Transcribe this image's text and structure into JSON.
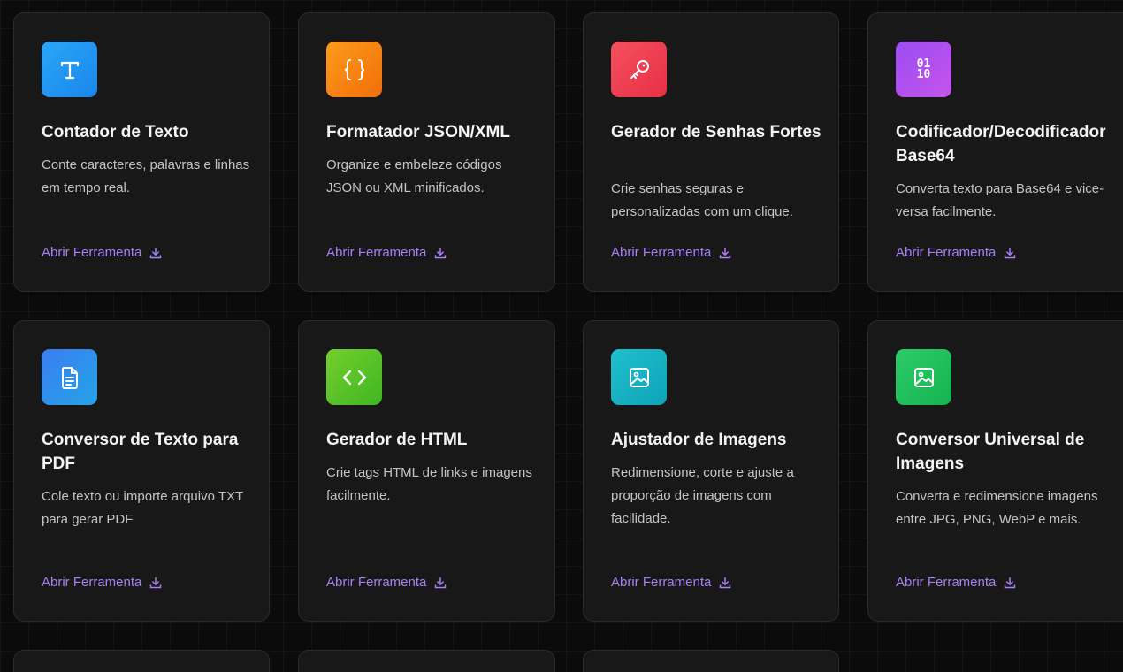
{
  "tools": [
    {
      "title": "Contador de Texto",
      "description": "Conte caracteres, palavras e linhas em tempo real.",
      "link": "Abrir Ferramenta",
      "icon": "text-icon",
      "color": "#2196f3"
    },
    {
      "title": "Formatador JSON/XML",
      "description": "Organize e embeleze códigos JSON ou XML minificados.",
      "link": "Abrir Ferramenta",
      "icon": "braces-icon",
      "color": "#f7870f"
    },
    {
      "title": "Gerador de Senhas Fortes",
      "description": "Crie senhas seguras e personalizadas com um clique.",
      "link": "Abrir Ferramenta",
      "icon": "key-icon",
      "color": "#f03e4e"
    },
    {
      "title": "Codificador/Decodificador Base64",
      "description": "Converta texto para Base64 e vice-versa facilmente.",
      "link": "Abrir Ferramenta",
      "icon": "binary-icon",
      "icon_text": "01 10",
      "color": "#b14ff0"
    },
    {
      "title": "Conversor de Texto para PDF",
      "description": "Cole texto ou importe arquivo TXT para gerar PDF",
      "link": "Abrir Ferramenta",
      "icon": "document-icon",
      "color": "#2f8af0"
    },
    {
      "title": "Gerador de HTML",
      "description": "Crie tags HTML de links e imagens facilmente.",
      "link": "Abrir Ferramenta",
      "icon": "code-icon",
      "color": "#5cc21e"
    },
    {
      "title": "Ajustador de Imagens",
      "description": "Redimensione, corte e ajuste a proporção de imagens com facilidade.",
      "link": "Abrir Ferramenta",
      "icon": "image-icon",
      "color": "#14b4c4"
    },
    {
      "title": "Conversor Universal de Imagens",
      "description": "Converta e redimensione imagens entre JPG, PNG, WebP e mais.",
      "link": "Abrir Ferramenta",
      "icon": "image-icon",
      "color": "#20c35e"
    }
  ],
  "colors": {
    "background": "#0b0b0c",
    "card": "#181818",
    "link": "#a97ef5"
  }
}
